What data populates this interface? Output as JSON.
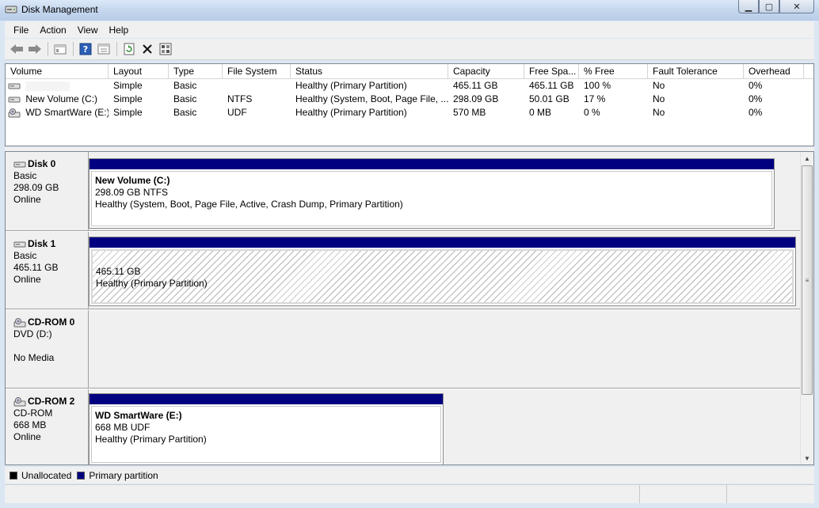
{
  "window": {
    "title": "Disk Management",
    "min_glyph": "▁",
    "max_glyph": "▢",
    "close_glyph": "✕"
  },
  "menu": [
    "File",
    "Action",
    "View",
    "Help"
  ],
  "toolbar": [
    "back-icon",
    "forward-icon",
    "console-tree-icon",
    "help-icon",
    "properties-icon",
    "refresh-icon",
    "delete-icon",
    "rescan-icon"
  ],
  "volume_list": {
    "columns": [
      "Volume",
      "Layout",
      "Type",
      "File System",
      "Status",
      "Capacity",
      "Free Spa...",
      "% Free",
      "Fault Tolerance",
      "Overhead"
    ],
    "rows": [
      {
        "volume": "",
        "layout": "Simple",
        "type": "Basic",
        "fs": "",
        "status": "Healthy (Primary Partition)",
        "capacity": "465.11 GB",
        "free": "465.11 GB",
        "pct": "100 %",
        "fault": "No",
        "overhead": "0%"
      },
      {
        "volume": "New Volume (C:)",
        "layout": "Simple",
        "type": "Basic",
        "fs": "NTFS",
        "status": "Healthy (System, Boot, Page File, ...",
        "capacity": "298.09 GB",
        "free": "50.01 GB",
        "pct": "17 %",
        "fault": "No",
        "overhead": "0%"
      },
      {
        "volume": "WD SmartWare (E:)",
        "layout": "Simple",
        "type": "Basic",
        "fs": "UDF",
        "status": "Healthy (Primary Partition)",
        "capacity": "570 MB",
        "free": "0 MB",
        "pct": "0 %",
        "fault": "No",
        "overhead": "0%"
      }
    ]
  },
  "disks": [
    {
      "name": "Disk 0",
      "type": "Basic",
      "size": "298.09 GB",
      "state": "Online",
      "partition": {
        "label": "New Volume  (C:)",
        "size": "298.09 GB NTFS",
        "status": "Healthy (System, Boot, Page File, Active, Crash Dump, Primary Partition)"
      }
    },
    {
      "name": "Disk 1",
      "type": "Basic",
      "size": "465.11 GB",
      "state": "Online",
      "partition": {
        "label": "",
        "size": "465.11 GB",
        "status": "Healthy (Primary Partition)"
      }
    },
    {
      "name": "CD-ROM 0",
      "type": "DVD (D:)",
      "size": "",
      "state": "No Media"
    },
    {
      "name": "CD-ROM 2",
      "type": "CD-ROM",
      "size": "668 MB",
      "state": "Online",
      "partition": {
        "label": "WD SmartWare  (E:)",
        "size": "668 MB UDF",
        "status": "Healthy (Primary Partition)"
      }
    }
  ],
  "legend": [
    {
      "label": "Unallocated",
      "color": "#000000"
    },
    {
      "label": "Primary partition",
      "color": "#000080"
    }
  ],
  "colors": {
    "primary_partition": "#000080",
    "unallocated": "#000000"
  }
}
